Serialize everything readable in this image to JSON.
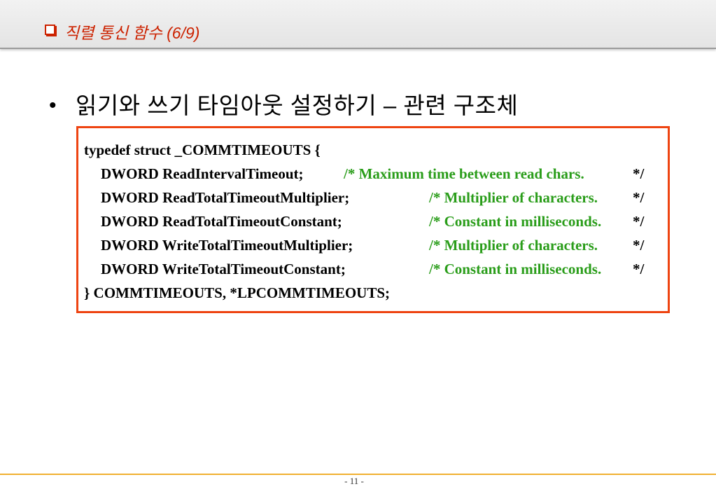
{
  "header": {
    "title": "직렬 통신 함수 (6/9)"
  },
  "bullet": {
    "text": "읽기와 쓰기 타임아웃 설정하기 – 관련 구조체"
  },
  "code": {
    "open": "typedef struct _COMMTIMEOUTS {",
    "fields": [
      {
        "decl": "DWORD ReadIntervalTimeout;",
        "comment": "/* Maximum time between read chars.",
        "end": "*/"
      },
      {
        "decl": "DWORD ReadTotalTimeoutMultiplier;",
        "comment": "/* Multiplier of characters.",
        "end": "*/"
      },
      {
        "decl": "DWORD ReadTotalTimeoutConstant;",
        "comment": "/* Constant in milliseconds.",
        "end": "*/"
      },
      {
        "decl": "DWORD WriteTotalTimeoutMultiplier;",
        "comment": "/* Multiplier of characters.",
        "end": "*/"
      },
      {
        "decl": "DWORD WriteTotalTimeoutConstant;",
        "comment": "/* Constant in milliseconds.",
        "end": "*/"
      }
    ],
    "close": "} COMMTIMEOUTS, *LPCOMMTIMEOUTS;"
  },
  "footer": {
    "page_number": "- 11 -"
  },
  "colors": {
    "title": "#cc2200",
    "box_border": "#ee4411",
    "comment": "#2a9d1a",
    "footer_rule": "#f0b030"
  }
}
